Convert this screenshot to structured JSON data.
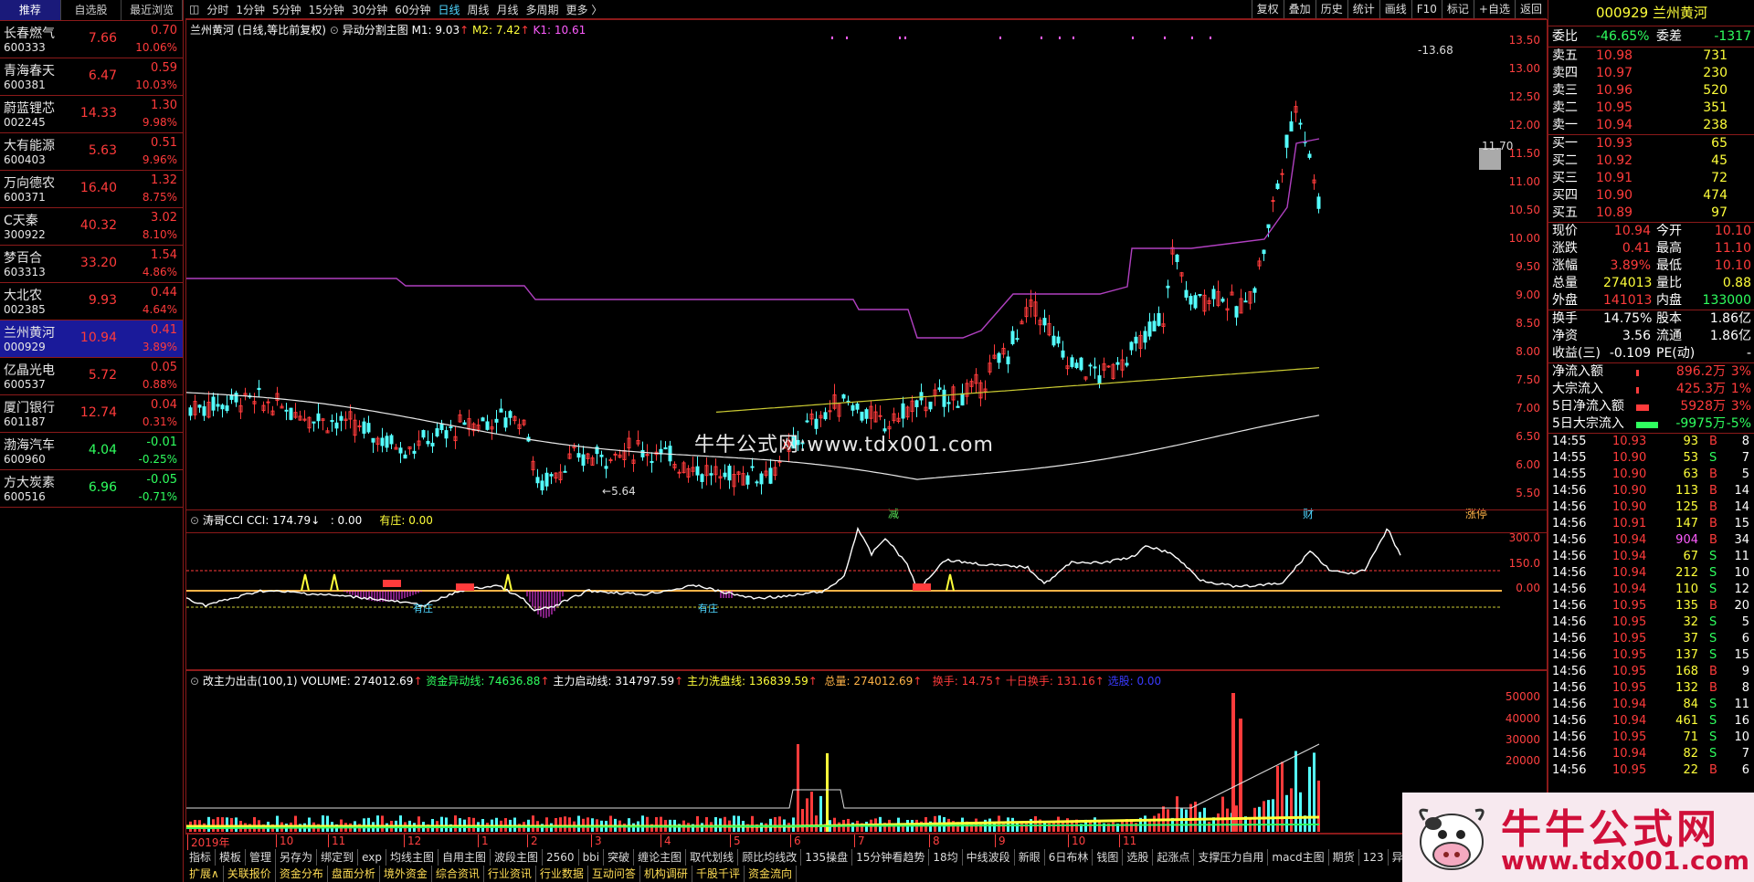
{
  "left_tabs": [
    "推荐",
    "自选股",
    "最近浏览"
  ],
  "stocks": [
    {
      "name": "长春燃气",
      "code": "600333",
      "price": "7.66",
      "change": "0.70",
      "pct": "10.06%",
      "dir": "up"
    },
    {
      "name": "青海春天",
      "code": "600381",
      "price": "6.47",
      "change": "0.59",
      "pct": "10.03%",
      "dir": "up"
    },
    {
      "name": "蔚蓝锂芯",
      "code": "002245",
      "price": "14.33",
      "change": "1.30",
      "pct": "9.98%",
      "dir": "up"
    },
    {
      "name": "大有能源",
      "code": "600403",
      "price": "5.63",
      "change": "0.51",
      "pct": "9.96%",
      "dir": "up"
    },
    {
      "name": "万向德农",
      "code": "600371",
      "price": "16.40",
      "change": "1.32",
      "pct": "8.75%",
      "dir": "up"
    },
    {
      "name": "C天秦",
      "code": "300922",
      "price": "40.32",
      "change": "3.02",
      "pct": "8.10%",
      "dir": "up"
    },
    {
      "name": "梦百合",
      "code": "603313",
      "price": "33.20",
      "change": "1.54",
      "pct": "4.86%",
      "dir": "up"
    },
    {
      "name": "大北农",
      "code": "002385",
      "price": "9.93",
      "change": "0.44",
      "pct": "4.64%",
      "dir": "up"
    },
    {
      "name": "兰州黄河",
      "code": "000929",
      "price": "10.94",
      "change": "0.41",
      "pct": "3.89%",
      "dir": "up",
      "selected": true
    },
    {
      "name": "亿晶光电",
      "code": "600537",
      "price": "5.72",
      "change": "0.05",
      "pct": "0.88%",
      "dir": "up"
    },
    {
      "name": "厦门银行",
      "code": "601187",
      "price": "12.74",
      "change": "0.04",
      "pct": "0.31%",
      "dir": "up"
    },
    {
      "name": "渤海汽车",
      "code": "600960",
      "price": "4.04",
      "change": "-0.01",
      "pct": "-0.25%",
      "dir": "down"
    },
    {
      "name": "方大炭素",
      "code": "600516",
      "price": "6.96",
      "change": "-0.05",
      "pct": "-0.71%",
      "dir": "down"
    }
  ],
  "period_bar": [
    "分时",
    "1分钟",
    "5分钟",
    "15分钟",
    "30分钟",
    "60分钟",
    "日线",
    "周线",
    "月线",
    "多周期",
    "更多 〉"
  ],
  "active_period": "日线",
  "tool_right": [
    "复权",
    "叠加",
    "历史",
    "统计",
    "画线",
    "F10",
    "标记",
    "+自选",
    "返回"
  ],
  "main_title": {
    "name": "兰州黄河 (日线,等比前复权)",
    "indicator": "异动分割主图",
    "m1": "M1: 9.03",
    "m2": "M2: 7.42",
    "k1": "K1: 10.61"
  },
  "price_axis": [
    "13.50",
    "13.00",
    "12.50",
    "12.00",
    "11.50",
    "11.00",
    "10.50",
    "10.00",
    "9.50",
    "9.00",
    "8.50",
    "8.00",
    "7.50",
    "7.00",
    "6.50",
    "6.00",
    "5.50"
  ],
  "price_annotations": {
    "high": "13.68",
    "low": "5.64",
    "last": "11.70"
  },
  "watermark_text": "牛牛公式网:www.tdx001.com",
  "chart_marks": [
    "减",
    "财",
    "涨停"
  ],
  "cci_title": {
    "name": "涛哥CCI",
    "cci": "CCI: 174.79",
    "v1": ": 0.00",
    "v2": "有庄: 0.00"
  },
  "cci_axis": [
    "300.0",
    "150.0",
    "0.00"
  ],
  "cci_labels": [
    "有庄",
    "有庄"
  ],
  "vol_title": {
    "name": "改主力出击(100,1)",
    "volume": "VOLUME: 274012.69",
    "abnormal": "资金异动线: 74636.88",
    "start": "主力启动线: 314797.59",
    "wash": "主力洗盘线: 136839.59",
    "total": "总量: 274012.69",
    "turnover": "换手: 14.75",
    "ten_day": "十日换手: 131.16",
    "pick": "选股: 0.00"
  },
  "vol_axis": [
    "50000",
    "40000",
    "30000",
    "20000"
  ],
  "date_axis": [
    "2019年",
    "10",
    "11",
    "12",
    "1",
    "2",
    "3",
    "4",
    "5",
    "6",
    "7",
    "8",
    "9",
    "10",
    "11"
  ],
  "bottom_tabs_1": [
    "指标",
    "模板",
    "管理",
    "另存为",
    "绑定到",
    "exp",
    "均线主图",
    "自用主图",
    "波段主图",
    "2560",
    "bbi",
    "突破",
    "缠论主图",
    "取代划线",
    "顾比均线改",
    "135操盘",
    "15分钟看趋势",
    "18均",
    "中线波段",
    "新眼",
    "6日布林",
    "钱图",
    "选股",
    "起涨点",
    "支撑压力自用",
    "macd主图",
    "期货",
    "123",
    "异动分割"
  ],
  "bottom_tabs_2": [
    "扩展∧",
    "关联报价",
    "资金分布",
    "盘面分析",
    "境外资金",
    "综合资讯",
    "行业资讯",
    "行业数据",
    "互动问答",
    "机构调研",
    "千股千评",
    "资金流向"
  ],
  "quote": {
    "code": "000929",
    "name": "兰州黄河",
    "weibi_label": "委比",
    "weibi": "-46.65%",
    "weicha_label": "委差",
    "weicha": "-1317",
    "asks": [
      {
        "label": "卖五",
        "price": "10.98",
        "vol": "731"
      },
      {
        "label": "卖四",
        "price": "10.97",
        "vol": "230"
      },
      {
        "label": "卖三",
        "price": "10.96",
        "vol": "520"
      },
      {
        "label": "卖二",
        "price": "10.95",
        "vol": "351"
      },
      {
        "label": "卖一",
        "price": "10.94",
        "vol": "238"
      }
    ],
    "bids": [
      {
        "label": "买一",
        "price": "10.93",
        "vol": "65"
      },
      {
        "label": "买二",
        "price": "10.92",
        "vol": "45"
      },
      {
        "label": "买三",
        "price": "10.91",
        "vol": "72"
      },
      {
        "label": "买四",
        "price": "10.90",
        "vol": "474"
      },
      {
        "label": "买五",
        "price": "10.89",
        "vol": "97"
      }
    ],
    "stats": [
      {
        "l1": "现价",
        "v1": "10.94",
        "c1": "red",
        "l2": "今开",
        "v2": "10.10",
        "c2": "red"
      },
      {
        "l1": "涨跌",
        "v1": "0.41",
        "c1": "red",
        "l2": "最高",
        "v2": "11.10",
        "c2": "red"
      },
      {
        "l1": "涨幅",
        "v1": "3.89%",
        "c1": "red",
        "l2": "最低",
        "v2": "10.10",
        "c2": "red"
      },
      {
        "l1": "总量",
        "v1": "274013",
        "c1": "yellow",
        "l2": "量比",
        "v2": "0.88",
        "c2": "yellow"
      },
      {
        "l1": "外盘",
        "v1": "141013",
        "c1": "red",
        "l2": "内盘",
        "v2": "133000",
        "c2": "green"
      }
    ],
    "stats2": [
      {
        "l1": "换手",
        "v1": "14.75%",
        "l2": "股本",
        "v2": "1.86亿"
      },
      {
        "l1": "净资",
        "v1": "3.56",
        "l2": "流通",
        "v2": "1.86亿"
      },
      {
        "l1": "收益(三)",
        "v1": "-0.109",
        "l2": "PE(动)",
        "v2": "-"
      }
    ],
    "flows": [
      {
        "label": "净流入额",
        "value": "896.2万",
        "pct": "3%",
        "dir": "up"
      },
      {
        "label": "大宗流入",
        "value": "425.3万",
        "pct": "1%",
        "dir": "up"
      },
      {
        "label": "5日净流入额",
        "value": "5928万",
        "pct": "3%",
        "dir": "up"
      },
      {
        "label": "5日大宗流入",
        "value": "-9975万",
        "pct": "-5%",
        "dir": "down"
      }
    ],
    "ticks": [
      {
        "t": "14:55",
        "p": "10.93",
        "v": "93",
        "bs": "B",
        "n": "8"
      },
      {
        "t": "14:55",
        "p": "10.90",
        "v": "53",
        "bs": "S",
        "n": "7"
      },
      {
        "t": "14:55",
        "p": "10.90",
        "v": "63",
        "bs": "B",
        "n": "5"
      },
      {
        "t": "14:56",
        "p": "10.90",
        "v": "113",
        "bs": "B",
        "n": "14"
      },
      {
        "t": "14:56",
        "p": "10.90",
        "v": "125",
        "bs": "B",
        "n": "14"
      },
      {
        "t": "14:56",
        "p": "10.91",
        "v": "147",
        "bs": "B",
        "n": "15"
      },
      {
        "t": "14:56",
        "p": "10.94",
        "v": "904",
        "bs": "B",
        "n": "34"
      },
      {
        "t": "14:56",
        "p": "10.94",
        "v": "67",
        "bs": "S",
        "n": "11"
      },
      {
        "t": "14:56",
        "p": "10.94",
        "v": "212",
        "bs": "S",
        "n": "10"
      },
      {
        "t": "14:56",
        "p": "10.94",
        "v": "110",
        "bs": "S",
        "n": "12"
      },
      {
        "t": "14:56",
        "p": "10.95",
        "v": "135",
        "bs": "B",
        "n": "20"
      },
      {
        "t": "14:56",
        "p": "10.95",
        "v": "32",
        "bs": "S",
        "n": "5"
      },
      {
        "t": "14:56",
        "p": "10.95",
        "v": "37",
        "bs": "S",
        "n": "6"
      },
      {
        "t": "14:56",
        "p": "10.95",
        "v": "137",
        "bs": "S",
        "n": "15"
      },
      {
        "t": "14:56",
        "p": "10.95",
        "v": "168",
        "bs": "B",
        "n": "9"
      },
      {
        "t": "14:56",
        "p": "10.95",
        "v": "132",
        "bs": "B",
        "n": "8"
      },
      {
        "t": "14:56",
        "p": "10.94",
        "v": "84",
        "bs": "S",
        "n": "11"
      },
      {
        "t": "14:56",
        "p": "10.94",
        "v": "461",
        "bs": "S",
        "n": "16"
      },
      {
        "t": "14:56",
        "p": "10.95",
        "v": "71",
        "bs": "S",
        "n": "10"
      },
      {
        "t": "14:56",
        "p": "10.94",
        "v": "82",
        "bs": "S",
        "n": "7"
      },
      {
        "t": "14:56",
        "p": "10.95",
        "v": "22",
        "bs": "B",
        "n": "6"
      }
    ]
  },
  "logo": {
    "title": "牛牛公式网",
    "url": "www.tdx001.com"
  },
  "colors": {
    "up": "#ff3b3b",
    "down": "#2fff5f",
    "panel_border": "#8b1a1a",
    "selected": "#1a1a9a"
  }
}
